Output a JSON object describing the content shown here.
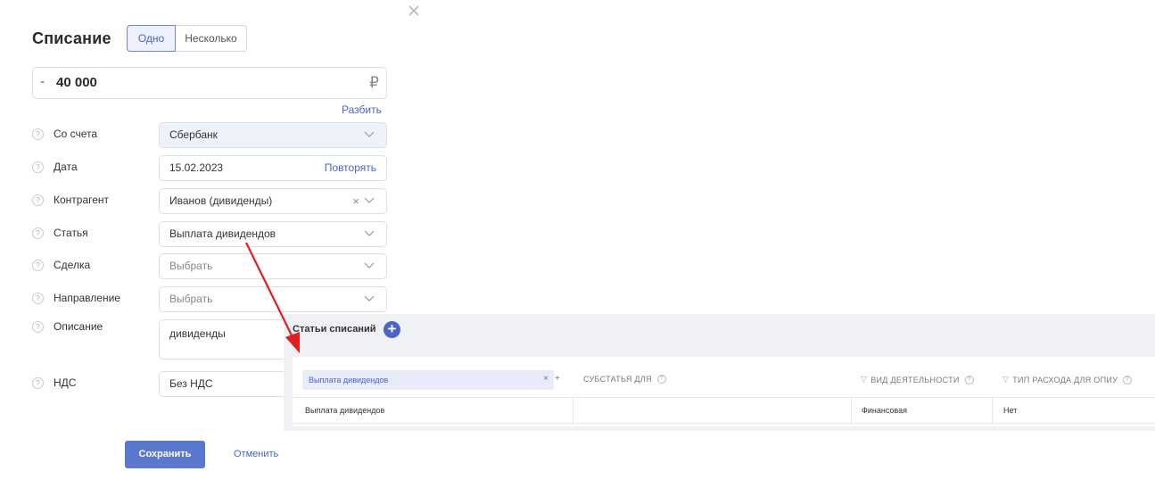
{
  "form": {
    "title": "Списание",
    "mode_one": "Одно",
    "mode_many": "Несколько",
    "amount_sign": "-",
    "amount": "40 000",
    "currency": "₽",
    "split_link": "Разбить",
    "help_glyph": "?",
    "fields": {
      "account": {
        "label": "Со счета",
        "value": "Сбербанк"
      },
      "date": {
        "label": "Дата",
        "value": "15.02.2023",
        "action": "Повторять"
      },
      "counterparty": {
        "label": "Контрагент",
        "value": "Иванов (дивиденды)",
        "clear": "×"
      },
      "article": {
        "label": "Статья",
        "value": "Выплата дивидендов"
      },
      "deal": {
        "label": "Сделка",
        "placeholder": "Выбрать"
      },
      "direction": {
        "label": "Направление",
        "placeholder": "Выбрать"
      },
      "description": {
        "label": "Описание",
        "value": "дивиденды"
      },
      "vat": {
        "label": "НДС",
        "value": "Без НДС"
      }
    },
    "save_label": "Сохранить",
    "cancel_label": "Отменить"
  },
  "inset": {
    "title": "Статьи списаний",
    "add_glyph": "+",
    "filter_chip": "Выплата дивидендов",
    "chip_clear": "×",
    "chip_add": "+",
    "columns": [
      "СУБСТАТЬЯ ДЛЯ",
      "ВИД ДЕЯТЕЛЬНОСТИ",
      "ТИП РАСХОДА ДЛЯ ОПИУ"
    ],
    "row": [
      "Выплата дивидендов",
      "",
      "Финансовая",
      "Нет"
    ]
  },
  "colors": {
    "accent": "#4a65c5",
    "save_button": "#5a79ce",
    "arrow": "#e02020"
  }
}
